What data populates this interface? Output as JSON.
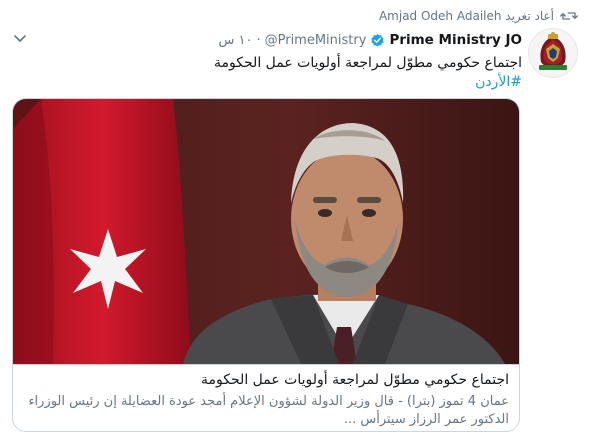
{
  "retweet": {
    "text": "Amjad Odeh Adaileh أعاد تغريد"
  },
  "tweet": {
    "display_name": "Prime Ministry JO",
    "handle": "@PrimeMinistry",
    "separator": "·",
    "time": "١٠ س",
    "text": "اجتماع حكومي مطوّل لمراجعة أولويات عمل الحكومة",
    "hashtag": "#الأردن"
  },
  "card": {
    "title": "اجتماع حكومي مطوّل لمراجعة أولويات عمل الحكومة",
    "description": "عمان 4 تموز (بترا) - قال وزير الدولة لشؤون الإعلام أمجد عودة العضايلة إن رئيس الوزراء الدكتور عمر الرزاز سيترأس ..."
  },
  "icons": {
    "retweet": "retweet-icon",
    "verified": "verified-badge-icon",
    "menu": "chevron-down-icon",
    "avatar": "jordan-coat-of-arms"
  },
  "colors": {
    "link": "#1b95e0",
    "secondary_text": "#657786",
    "verified": "#1da1f2",
    "flag_red": "#c8102e"
  }
}
